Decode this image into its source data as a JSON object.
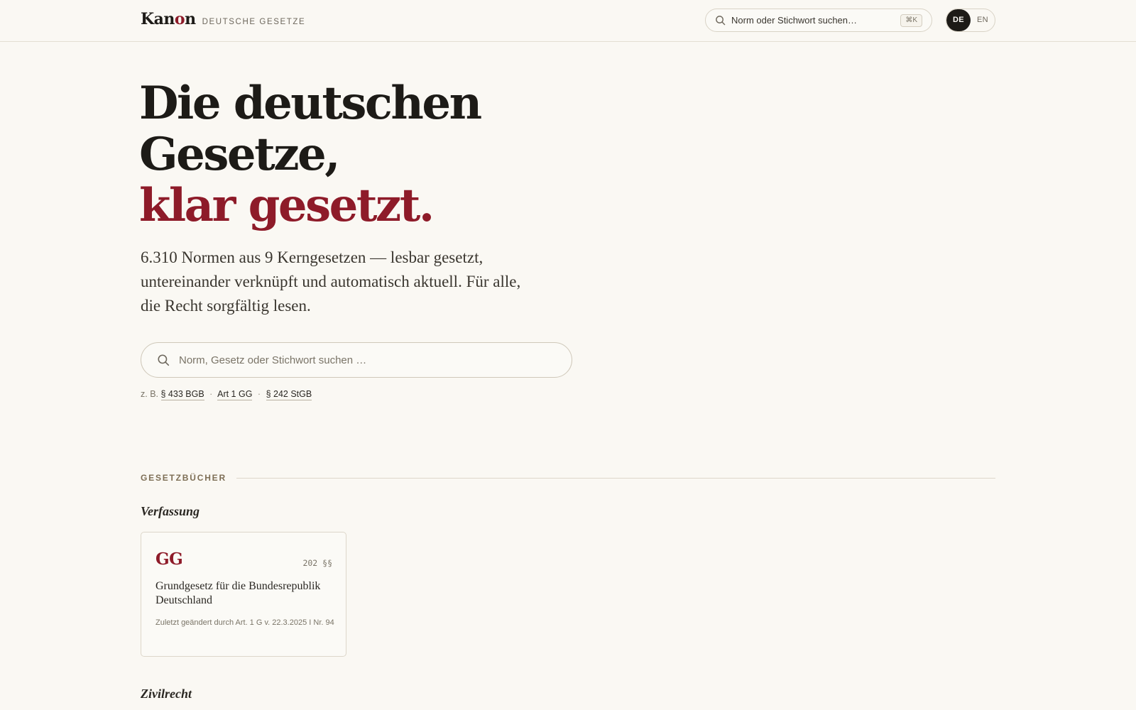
{
  "header": {
    "brand_pre": "Ka",
    "brand_mid": "n",
    "brand_accent": "o",
    "brand_post": "n",
    "brand_subtitle": "DEUTSCHE GESETZE",
    "search_placeholder": "Norm oder Stichwort suchen…",
    "search_shortcut": "⌘K",
    "languages": [
      {
        "code": "DE",
        "active": true
      },
      {
        "code": "EN",
        "active": false
      }
    ]
  },
  "hero": {
    "title_line1": "Die deutschen",
    "title_line2": "Gesetze,",
    "title_line3": "klar gesetzt.",
    "subtitle": "6.310 Normen aus 9 Kerngesetzen — lesbar gesetzt, untereinander verknüpft und automatisch aktuell. Für alle, die Recht sorgfältig lesen.",
    "search_placeholder": "Norm, Gesetz oder Stichwort suchen …",
    "examples_prefix": "z. B.",
    "examples": [
      "§ 433 BGB",
      "Art 1 GG",
      "§ 242 StGB"
    ],
    "examples_separator": "·"
  },
  "codes_section": {
    "label": "GESETZBÜCHER",
    "groups": [
      {
        "title": "Verfassung",
        "cards": [
          {
            "abbr": "GG",
            "count": "202 §§",
            "name": "Grundgesetz für die Bundesrepublik Deutschland",
            "note": "Zuletzt geändert durch Art. 1 G v. 22.3.2025 I Nr. 94"
          }
        ]
      },
      {
        "title": "Zivilrecht",
        "cards": []
      }
    ]
  },
  "colors": {
    "background": "#faf8f3",
    "accent": "#8e1b29",
    "ink": "#1d1b17"
  }
}
